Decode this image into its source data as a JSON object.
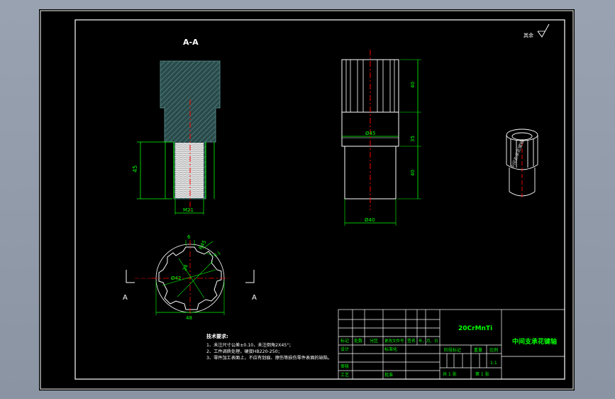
{
  "colors": {
    "canvas": "#000000",
    "frame": "#ffffff",
    "section_body": "#2f4f4f",
    "hatch": "#4f8080",
    "thread": "#d8d8d8",
    "thread_edge": "#00ff00",
    "centerline": "#ff0000",
    "dimension": "#00ff00",
    "outline": "#ffffff",
    "title_text": "#00ff00",
    "note_text": "#ffffff"
  },
  "drawing": {
    "section_label": "A-A",
    "cut_mark_left": "A",
    "cut_mark_right": "A",
    "roughness_note": "其余",
    "dims": {
      "section_height": "45",
      "thread_dia": "M21",
      "spline_width": "6",
      "spline_angle": "R45",
      "spline_chamfer": "0.1",
      "inner_dia": "Ø42",
      "tooth_dim": "24",
      "outer_dia": "48",
      "front_top": "40",
      "front_mid": "35",
      "front_bottom": "40",
      "front_mid_dia": "Ø45",
      "front_bottom_dia": "Ø40"
    }
  },
  "notes": {
    "title": "技术要求:",
    "line1": "1、未注尺寸公差±0.10，未注倒角2X45°；",
    "line2": "2、工件调质处理，硬度HB220-250；",
    "line3": "3、零件加工表面上，不应有划痕、擦伤等损伤零件表面的缺陷。"
  },
  "title_block": {
    "material": "20CrMnTi",
    "part_name": "中间支承花键轴",
    "h_mark": "标记",
    "h_count": "处数",
    "h_zone": "分区",
    "h_docno": "更改文件号",
    "h_sign": "签名",
    "h_date": "年、月、日",
    "h_design": "设计",
    "h_std": "标准化",
    "h_stage": "阶段标记",
    "h_weight": "重量",
    "h_scale": "比例",
    "scale_value": "1:1",
    "h_review": "审核",
    "h_process": "工艺",
    "h_approve": "批准",
    "sheet_total": "共 1 张",
    "sheet_no": "第 1 张"
  }
}
